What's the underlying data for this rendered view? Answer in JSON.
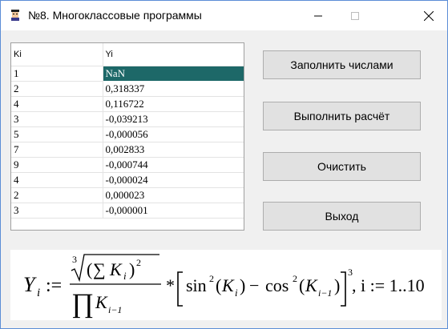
{
  "window": {
    "title": "№8. Многоклассовые программы"
  },
  "table": {
    "headers": [
      "Ki",
      "Yi"
    ],
    "rows": [
      {
        "k": "1",
        "y": "NaN"
      },
      {
        "k": "2",
        "y": "0,318337"
      },
      {
        "k": "4",
        "y": "0,116722"
      },
      {
        "k": "3",
        "y": "-0,039213"
      },
      {
        "k": "5",
        "y": "-0,000056"
      },
      {
        "k": "7",
        "y": "0,002833"
      },
      {
        "k": "9",
        "y": "-0,000744"
      },
      {
        "k": "4",
        "y": "-0,000024"
      },
      {
        "k": "2",
        "y": "0,000023"
      },
      {
        "k": "3",
        "y": "-0,000001"
      }
    ],
    "selected_row": 0
  },
  "buttons": {
    "fill": "Заполнить числами",
    "calc": "Выполнить расчёт",
    "clear": "Очистить",
    "exit": "Выход"
  },
  "formula": {
    "y_sym": "Y",
    "sub_i": "i",
    "assign": ":=",
    "root_index": "3",
    "sum": "∑",
    "k_sym": "K",
    "sq": "2",
    "prod": "∏",
    "sub_im1": "i−1",
    "star": "*",
    "sin": "sin",
    "cos": "cos",
    "minus": "−",
    "cube": "3",
    "range": ", i := 1..10"
  },
  "colors": {
    "selection": "#1d6868",
    "button_bg": "#e1e1e1",
    "window_bg": "#f0f0f0"
  }
}
